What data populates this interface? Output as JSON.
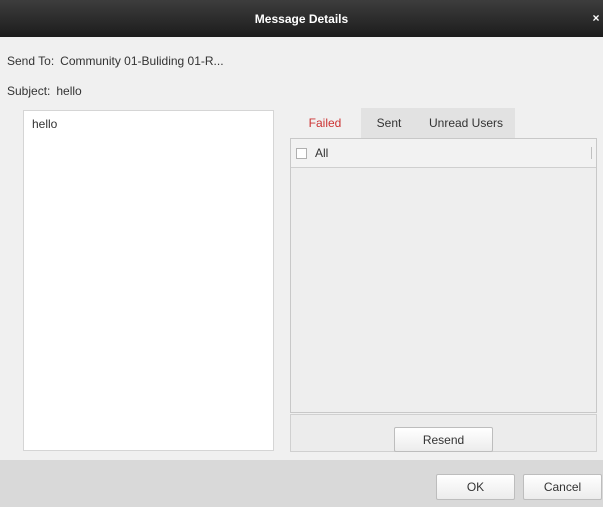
{
  "dialog": {
    "title": "Message Details",
    "close_glyph": "×"
  },
  "fields": {
    "send_to_label": "Send To:",
    "send_to_value": "Community 01-Buliding 01-R...",
    "subject_label": "Subject:",
    "subject_value": "hello"
  },
  "message": {
    "body": "hello"
  },
  "tabs": [
    {
      "label": "Failed",
      "active": true
    },
    {
      "label": "Sent",
      "active": false
    },
    {
      "label": "Unread Users",
      "active": false
    }
  ],
  "list": {
    "select_all_label": "All",
    "select_all_checked": false
  },
  "buttons": {
    "resend": "Resend",
    "ok": "OK",
    "cancel": "Cancel"
  },
  "colors": {
    "title_bar": "#2a2a2a",
    "active_tab_text": "#cc3333"
  }
}
